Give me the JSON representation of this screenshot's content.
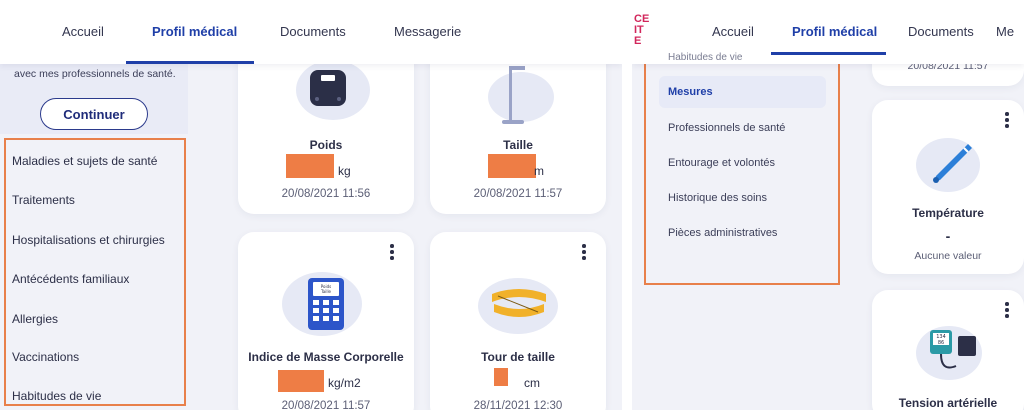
{
  "left": {
    "nav": {
      "tabs": [
        {
          "label": "Accueil"
        },
        {
          "label": "Profil médical"
        },
        {
          "label": "Documents"
        },
        {
          "label": "Messagerie"
        }
      ]
    },
    "sidebar": {
      "intro_text": "avec mes professionnels de santé.",
      "continue_label": "Continuer",
      "items": [
        {
          "label": "Maladies et sujets de santé"
        },
        {
          "label": "Traitements"
        },
        {
          "label": "Hospitalisations et chirurgies"
        },
        {
          "label": "Antécédents familiaux"
        },
        {
          "label": "Allergies"
        },
        {
          "label": "Vaccinations"
        },
        {
          "label": "Habitudes de vie"
        }
      ]
    },
    "cards": [
      {
        "title": "Poids",
        "unit": "kg",
        "date": "20/08/2021 11:56",
        "icon": "scale-icon"
      },
      {
        "title": "Taille",
        "unit": "m",
        "date": "20/08/2021 11:57",
        "icon": "height-gauge-icon"
      },
      {
        "title": "Indice de Masse Corporelle",
        "unit": "kg/m2",
        "date": "20/08/2021 11:57",
        "icon": "calculator-icon",
        "icon_text": "Poids Taille"
      },
      {
        "title": "Tour de taille",
        "unit": "cm",
        "date": "28/11/2021 12:30",
        "icon": "tape-measure-icon"
      }
    ]
  },
  "right": {
    "logo": "CE ITE",
    "nav": {
      "tabs": [
        {
          "label": "Accueil"
        },
        {
          "label": "Profil médical"
        },
        {
          "label": "Documents"
        },
        {
          "label": "Me"
        }
      ]
    },
    "submenu_header": "Habitudes de vie",
    "submenu": [
      {
        "label": "Mesures",
        "active": true
      },
      {
        "label": "Professionnels de santé"
      },
      {
        "label": "Entourage et volontés"
      },
      {
        "label": "Historique des soins"
      },
      {
        "label": "Pièces administratives"
      }
    ],
    "top_card_date": "20/08/2021 11:57",
    "cards": [
      {
        "title": "Température",
        "value": "-",
        "sub": "Aucune valeur",
        "icon": "thermometer-icon"
      },
      {
        "title": "Tension artérielle",
        "icon": "blood-pressure-monitor-icon",
        "icon_text": "134 86"
      }
    ]
  },
  "colors": {
    "accent": "#1f3fa8",
    "highlight": "#e8804b",
    "redaction": "#ee7d45"
  }
}
